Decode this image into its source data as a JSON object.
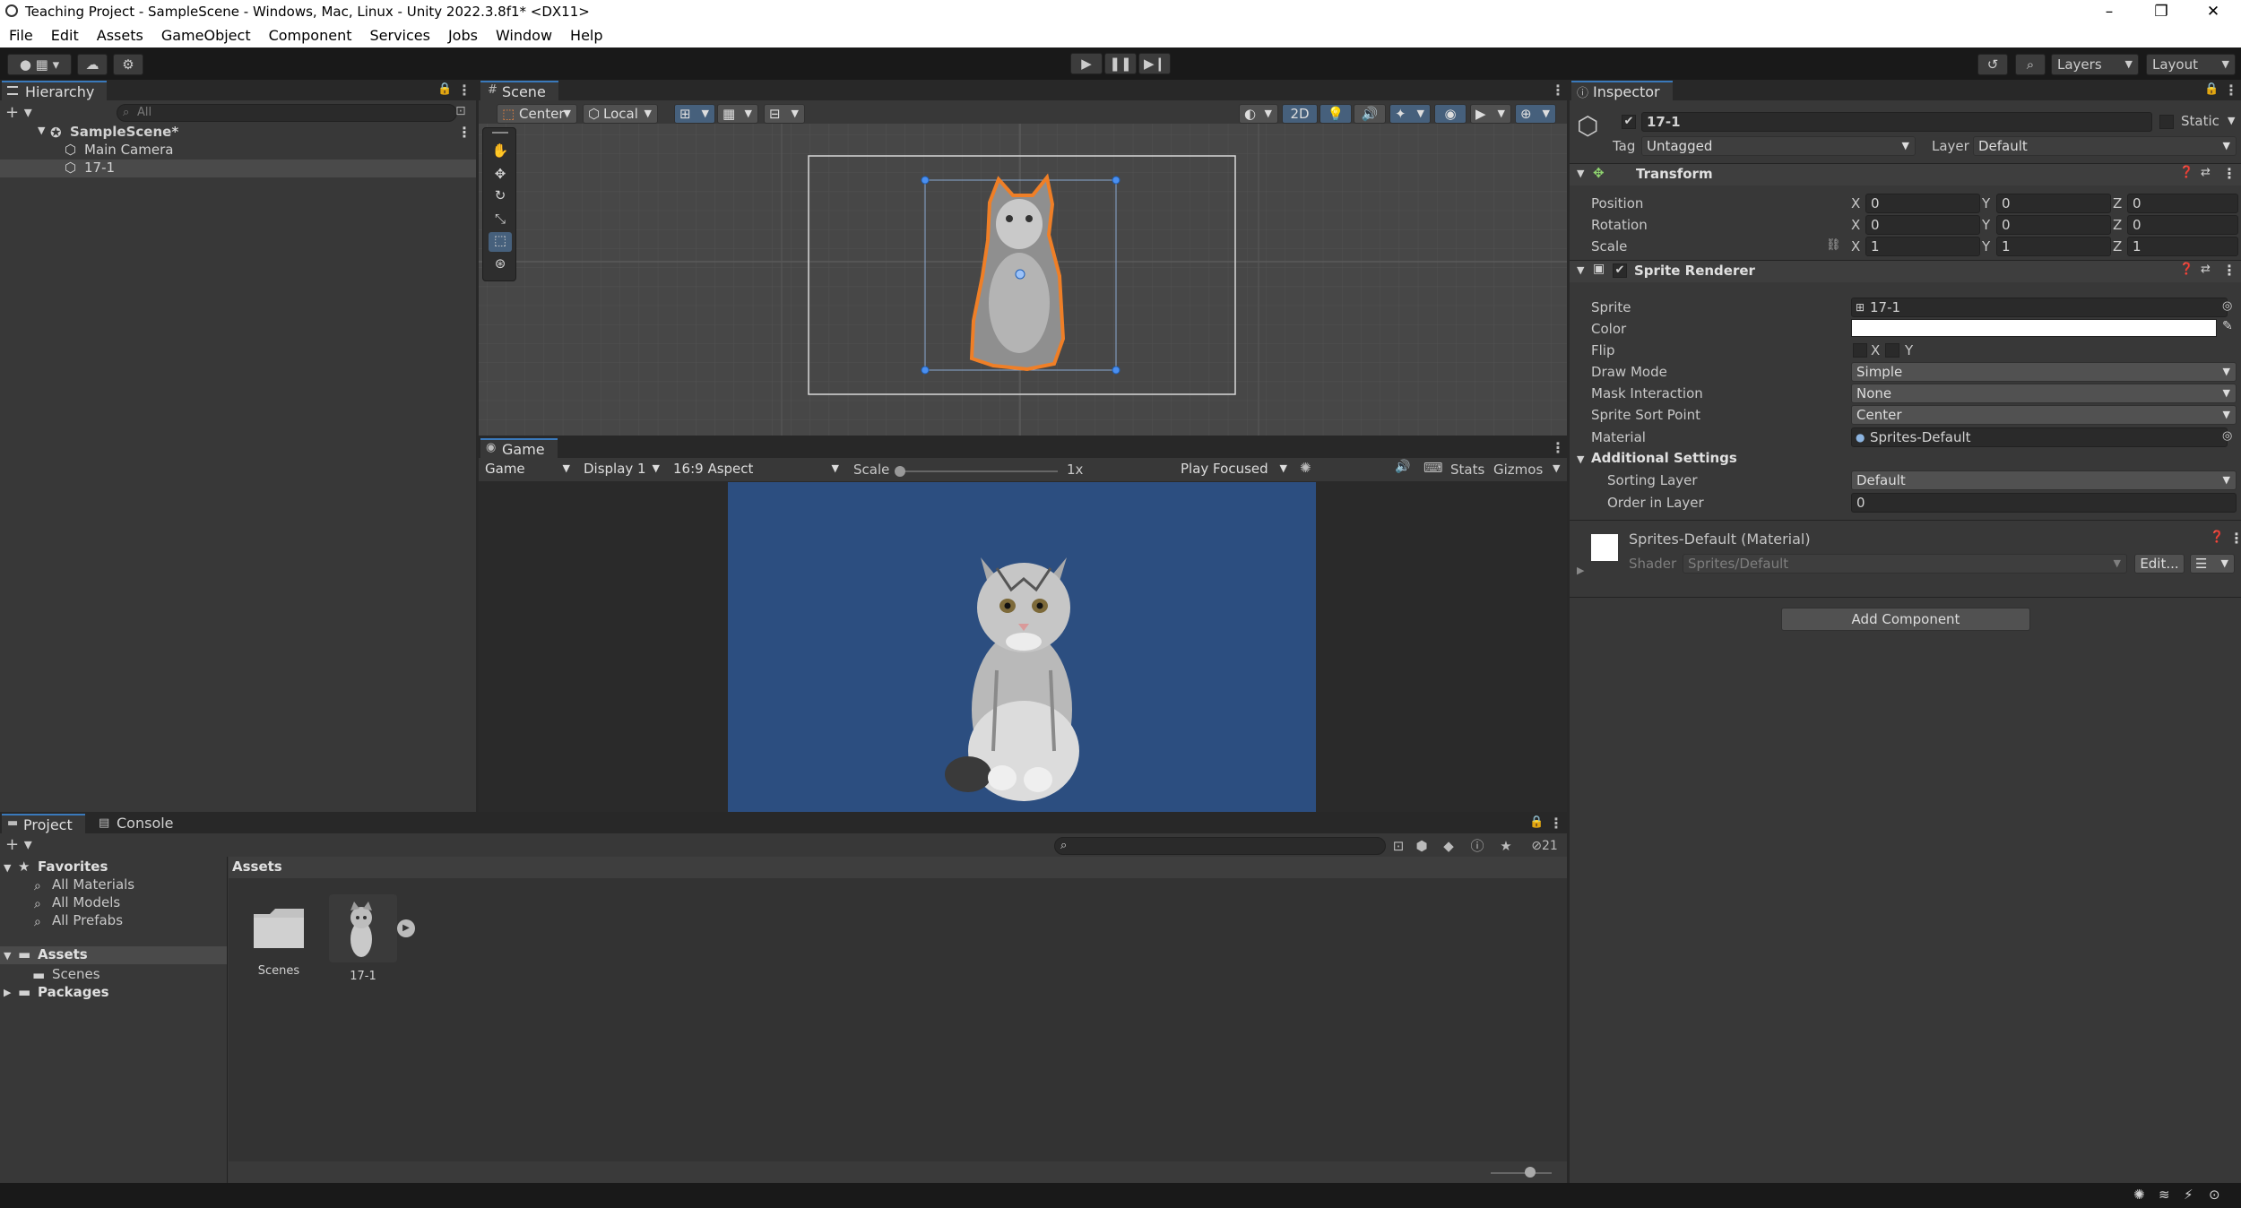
{
  "window": {
    "title": "Teaching Project - SampleScene - Windows, Mac, Linux - Unity 2022.3.8f1* <DX11>",
    "minimize": "–",
    "maximize": "❐",
    "close": "✕"
  },
  "menu": [
    "File",
    "Edit",
    "Assets",
    "GameObject",
    "Component",
    "Services",
    "Jobs",
    "Window",
    "Help"
  ],
  "toolbar": {
    "layers_label": "Layers",
    "layout_label": "Layout"
  },
  "hierarchy": {
    "tab": "Hierarchy",
    "search_placeholder": "All",
    "scene": "SampleScene*",
    "items": [
      "Main Camera",
      "17-1"
    ]
  },
  "scene": {
    "tab": "Scene",
    "pivot": "Center",
    "space": "Local",
    "mode_2d": "2D"
  },
  "game": {
    "tab": "Game",
    "mode": "Game",
    "display": "Display 1",
    "aspect": "16:9 Aspect",
    "scale_label": "Scale",
    "scale_value": "1x",
    "play_mode": "Play Focused",
    "stats": "Stats",
    "gizmos": "Gizmos",
    "background": "#2c4e80"
  },
  "inspector": {
    "tab": "Inspector",
    "object_name": "17-1",
    "static_label": "Static",
    "tag_label": "Tag",
    "tag_value": "Untagged",
    "layer_label": "Layer",
    "layer_value": "Default",
    "transform": {
      "title": "Transform",
      "rows": [
        {
          "label": "Position",
          "x": "0",
          "y": "0",
          "z": "0"
        },
        {
          "label": "Rotation",
          "x": "0",
          "y": "0",
          "z": "0"
        },
        {
          "label": "Scale",
          "x": "1",
          "y": "1",
          "z": "1"
        }
      ],
      "axis_x": "X",
      "axis_y": "Y",
      "axis_z": "Z"
    },
    "sprite_renderer": {
      "title": "Sprite Renderer",
      "sprite_label": "Sprite",
      "sprite_value": "17-1",
      "color_label": "Color",
      "flip_label": "Flip",
      "flip_x": "X",
      "flip_y": "Y",
      "draw_mode_label": "Draw Mode",
      "draw_mode": "Simple",
      "mask_label": "Mask Interaction",
      "mask_value": "None",
      "sort_point_label": "Sprite Sort Point",
      "sort_point": "Center",
      "material_label": "Material",
      "material_value": "Sprites-Default",
      "additional": "Additional Settings",
      "sorting_layer_label": "Sorting Layer",
      "sorting_layer": "Default",
      "order_label": "Order in Layer",
      "order_value": "0"
    },
    "material": {
      "title": "Sprites-Default (Material)",
      "shader_label": "Shader",
      "shader_value": "Sprites/Default",
      "edit": "Edit..."
    },
    "add_component": "Add Component"
  },
  "project": {
    "tab_project": "Project",
    "tab_console": "Console",
    "favorites": "Favorites",
    "favorite_items": [
      "All Materials",
      "All Models",
      "All Prefabs"
    ],
    "assets": "Assets",
    "assets_children": [
      "Scenes"
    ],
    "packages": "Packages",
    "breadcrumb": "Assets",
    "hidden_count": "21",
    "files": [
      {
        "name": "Scenes",
        "kind": "folder"
      },
      {
        "name": "17-1",
        "kind": "sprite"
      }
    ]
  }
}
